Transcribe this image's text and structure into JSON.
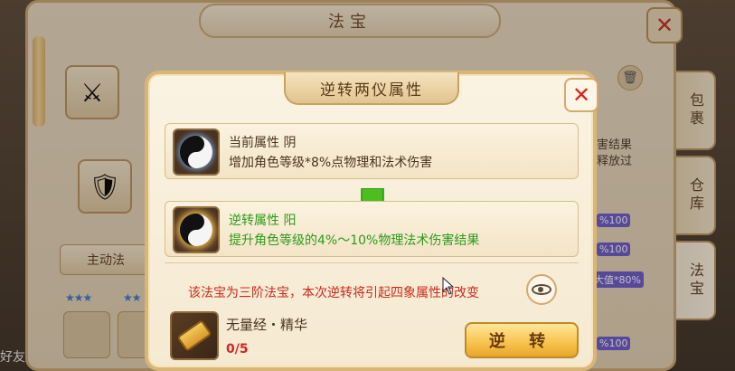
{
  "background_panel": {
    "title": "法宝",
    "tab_active_label": "主动法",
    "side_tabs": [
      "包裹",
      "仓库",
      "法宝"
    ],
    "right_text_lines": [
      "害结果",
      "释放过"
    ],
    "badges": [
      "%100",
      "%100",
      "大值*80%",
      "%100"
    ],
    "friend_label": "好友",
    "close_icon": "close-icon",
    "trash_icon": "trash-icon"
  },
  "dialog": {
    "title": "逆转两仪属性",
    "close_icon": "close-icon",
    "current_attribute": {
      "label": "当前属性 阴",
      "effect": "增加角色等级*8%点物理和法术伤害",
      "icon": "yin-yang-icon"
    },
    "arrow_icon": "down-arrow-icon",
    "reversed_attribute": {
      "label": "逆转属性 阳",
      "effect": "提升角色等级的4%～10%物理法术伤害结果",
      "icon": "yin-yang-icon"
    },
    "notice": "该法宝为三阶法宝，本次逆转将引起四象属性的改变",
    "preview_icon": "eye-icon",
    "material": {
      "name": "无量经・精华",
      "count": "0/5",
      "icon": "scroll-icon"
    },
    "reverse_button_label": "逆 转"
  },
  "colors": {
    "current_text": "#4a3520",
    "reversed_text": "#2e9a1b",
    "notice_text": "#cc2a1c",
    "count_text": "#d1281e",
    "arrow": "#4cbf1f"
  }
}
